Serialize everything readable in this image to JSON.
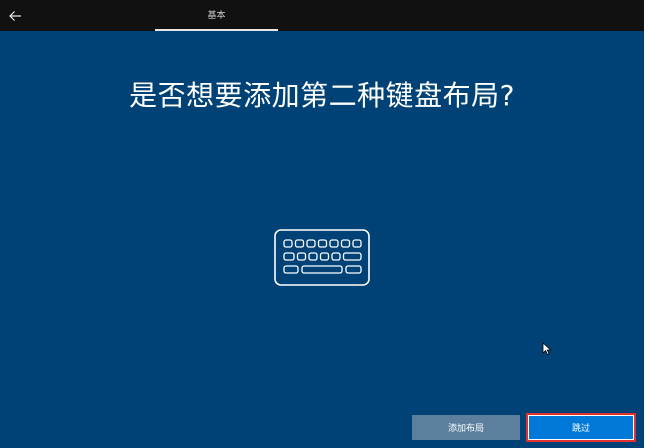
{
  "topbar": {
    "step_label": "基本"
  },
  "main": {
    "title": "是否想要添加第二种键盘布局?"
  },
  "actions": {
    "add_layout_label": "添加布局",
    "skip_label": "跳过"
  },
  "icons": {
    "back": "back-arrow-icon",
    "keyboard": "keyboard-icon",
    "cursor": "mouse-cursor-icon"
  },
  "colors": {
    "background": "#004275",
    "topbar": "#111111",
    "primary_button": "#0078d7",
    "secondary_button": "#5b7f9c",
    "focus_outline": "#e03030"
  }
}
